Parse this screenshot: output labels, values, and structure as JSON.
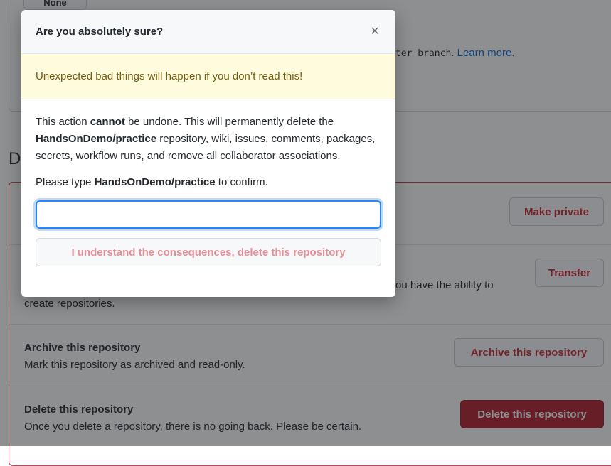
{
  "background": {
    "top_chip_label": "None",
    "note_mono": "ter branch",
    "note_after": ".",
    "note_link": "Learn more",
    "note_end": ".",
    "section_heading": "D",
    "make_private_label": "Make private",
    "transfer_label": "Transfer",
    "transfer_desc_line1": "ou have the ability to",
    "transfer_desc_line2": "create repositories.",
    "archive_title": "Archive this repository",
    "archive_desc": "Mark this repository as archived and read-only.",
    "archive_button": "Archive this repository",
    "delete_title": "Delete this repository",
    "delete_desc": "Once you delete a repository, there is no going back. Please be certain.",
    "delete_button": "Delete this repository"
  },
  "modal": {
    "title": "Are you absolutely sure?",
    "close_glyph": "×",
    "warning": "Unexpected bad things will happen if you don’t read this!",
    "body": {
      "p1": "This action ",
      "cannot": "cannot",
      "p2": " be undone. This will permanently delete the ",
      "repo": "HandsOnDemo/practice",
      "p3": " repository, wiki, issues, comments, packages, secrets, workflow runs, and remove all collaborator associations."
    },
    "confirm": {
      "before": "Please type ",
      "repo": "HandsOnDemo/practice",
      "after": " to confirm."
    },
    "input_value": "",
    "confirm_button": "I understand the consequences, delete this repository"
  },
  "colors": {
    "danger": "#cb2431",
    "danger_solid": "#b31d28",
    "warning_bg": "#fffbdd",
    "focus_border": "#2188ff",
    "link": "#0366d6"
  }
}
